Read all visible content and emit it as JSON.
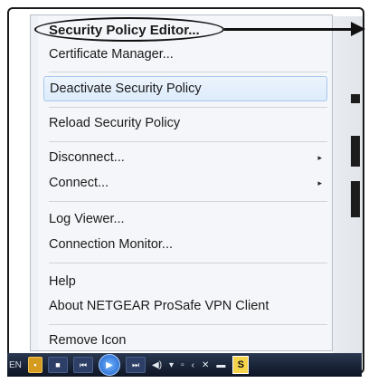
{
  "menu": {
    "items": [
      {
        "label": "Security Policy Editor...",
        "bold": true
      },
      {
        "label": "Certificate Manager..."
      },
      {
        "label": "Deactivate Security Policy",
        "highlighted": true
      },
      {
        "label": "Reload Security Policy"
      },
      {
        "label": "Disconnect...",
        "submenu": true
      },
      {
        "label": "Connect...",
        "submenu": true
      },
      {
        "label": "Log Viewer..."
      },
      {
        "label": "Connection Monitor..."
      },
      {
        "label": "Help"
      },
      {
        "label": "About NETGEAR ProSafe VPN Client"
      },
      {
        "label": "Remove Icon"
      }
    ],
    "submenu_arrow": "▸"
  },
  "taskbar": {
    "language": "EN",
    "icons": [
      "media-stop-icon",
      "media-prev-icon",
      "media-play-icon",
      "media-next-icon",
      "volume-icon",
      "network-icon",
      "vpn-client-icon"
    ]
  },
  "colors": {
    "menu_bg": "#f4f6f9",
    "highlight_bg": "#dcebfb",
    "highlight_border": "#a8c8ec",
    "taskbar": "#0d1424"
  }
}
